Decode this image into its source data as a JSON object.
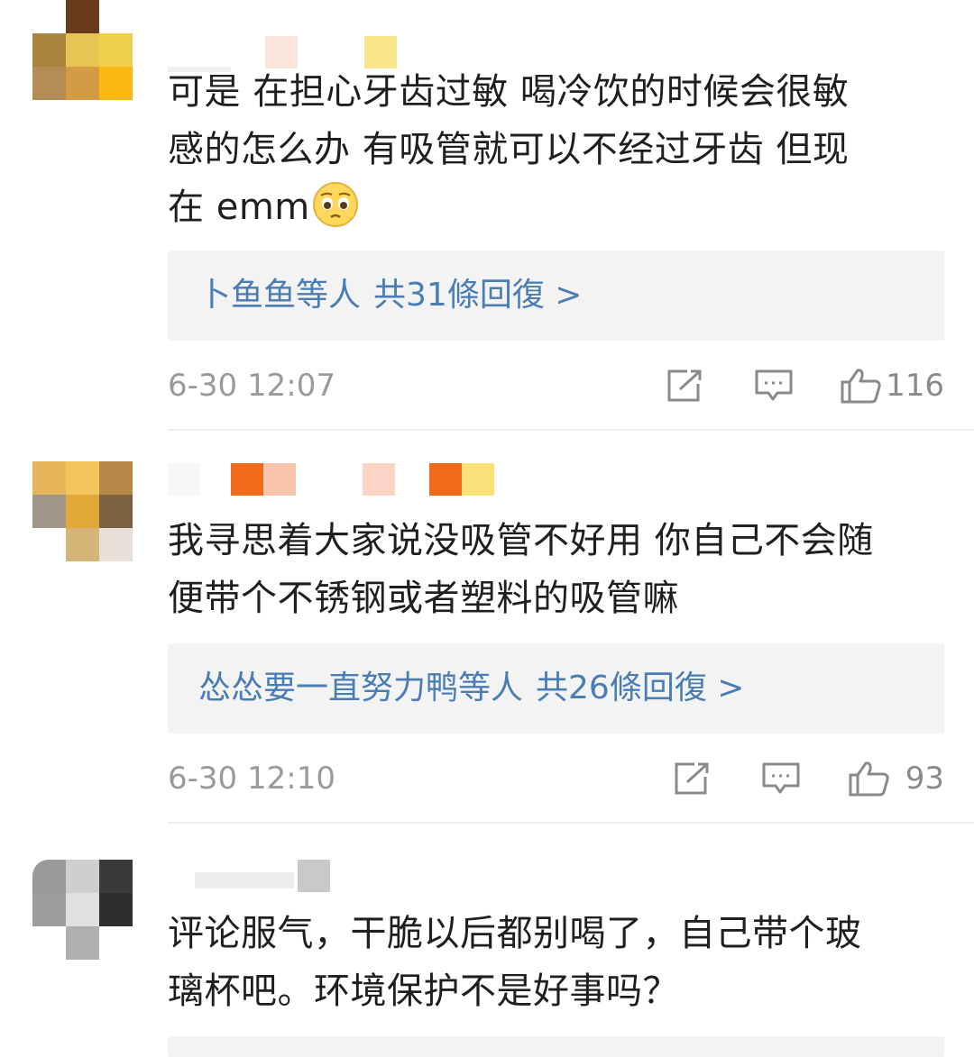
{
  "comments": [
    {
      "text_lines": [
        "可是 在担心牙齿过敏 喝冷饮的时候会很敏",
        "感的怎么办 有吸管就可以不经过牙齿 但现",
        "在 emm"
      ],
      "emoji": "pleading-face-emoji",
      "replies": {
        "names": "卜鱼鱼等人",
        "count": "共31條回復 >"
      },
      "time": "6-30 12:07",
      "likes": "116"
    },
    {
      "text_lines": [
        "我寻思着大家说没吸管不好用 你自己不会随",
        "便带个不锈钢或者塑料的吸管嘛"
      ],
      "replies": {
        "names": "怂怂要一直努力鸭等人",
        "count": "共26條回復 >"
      },
      "time": "6-30 12:10",
      "likes": "93"
    },
    {
      "text_lines": [
        "评论服气，干脆以后都别喝了，自己带个玻",
        "璃杯吧。环境保护不是好事吗？"
      ]
    }
  ],
  "icons": {
    "share": "share-icon",
    "comment": "comment-icon",
    "like": "thumbs-up-icon"
  },
  "colors": {
    "reply_link": "#4a7db4",
    "reply_bg": "#f3f3f3",
    "meta_text": "#9a9a9a"
  }
}
